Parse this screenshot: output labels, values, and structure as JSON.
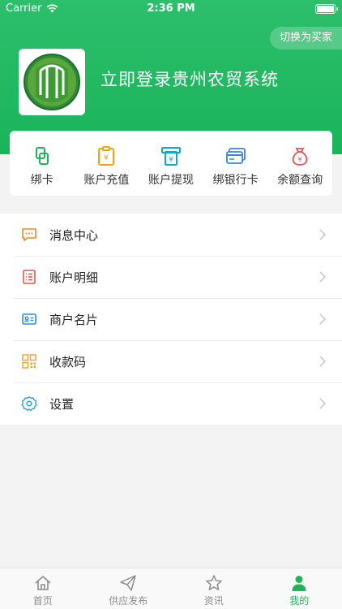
{
  "status_bar": {
    "carrier": "Carrier",
    "time": "2:36 PM"
  },
  "header": {
    "switch_label": "切换为买家",
    "login_title": "立即登录贵州农贸系统",
    "accent": "#1fb860"
  },
  "quick_actions": [
    {
      "label": "绑卡",
      "icon": "bind-card-icon"
    },
    {
      "label": "账户充值",
      "icon": "recharge-icon"
    },
    {
      "label": "账户提现",
      "icon": "withdraw-icon"
    },
    {
      "label": "绑银行卡",
      "icon": "bank-card-icon"
    },
    {
      "label": "余额查询",
      "icon": "money-bag-icon"
    }
  ],
  "menu": [
    {
      "label": "消息中心",
      "icon": "message-icon"
    },
    {
      "label": "账户明细",
      "icon": "list-icon"
    },
    {
      "label": "商户名片",
      "icon": "id-card-icon"
    },
    {
      "label": "收款码",
      "icon": "qr-code-icon"
    },
    {
      "label": "设置",
      "icon": "gear-icon"
    }
  ],
  "tabs": [
    {
      "label": "首页",
      "icon": "home-icon"
    },
    {
      "label": "供应发布",
      "icon": "send-icon"
    },
    {
      "label": "资讯",
      "icon": "star-icon"
    },
    {
      "label": "我的",
      "icon": "person-icon",
      "active": true
    }
  ]
}
